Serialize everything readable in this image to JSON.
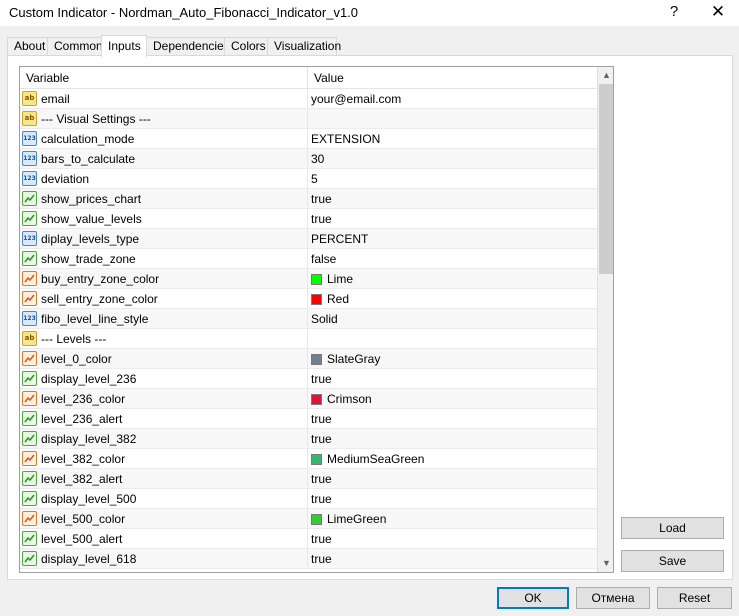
{
  "window": {
    "title": "Custom Indicator - Nordman_Auto_Fibonacci_Indicator_v1.0",
    "help_label": "?",
    "close_label": "✕"
  },
  "tabs": [
    {
      "label": "About"
    },
    {
      "label": "Common"
    },
    {
      "label": "Inputs",
      "active": true
    },
    {
      "label": "Dependencies"
    },
    {
      "label": "Colors"
    },
    {
      "label": "Visualization"
    }
  ],
  "grid": {
    "columns": {
      "variable": "Variable",
      "value": "Value"
    },
    "rows": [
      {
        "icon": "ab-string-icon",
        "type": "ab",
        "variable": "email",
        "value": "your@email.com"
      },
      {
        "icon": "ab-string-icon",
        "type": "ab",
        "variable": "--- Visual Settings ---",
        "value": ""
      },
      {
        "icon": "numeric-icon",
        "type": "num",
        "variable": "calculation_mode",
        "value": "EXTENSION"
      },
      {
        "icon": "numeric-icon",
        "type": "num",
        "variable": "bars_to_calculate",
        "value": "30"
      },
      {
        "icon": "numeric-icon",
        "type": "num",
        "variable": "deviation",
        "value": "5"
      },
      {
        "icon": "boolean-icon",
        "type": "bool",
        "variable": "show_prices_chart",
        "value": "true"
      },
      {
        "icon": "boolean-icon",
        "type": "bool",
        "variable": "show_value_levels",
        "value": "true"
      },
      {
        "icon": "numeric-icon",
        "type": "num",
        "variable": "diplay_levels_type",
        "value": "PERCENT"
      },
      {
        "icon": "boolean-icon",
        "type": "bool",
        "variable": "show_trade_zone",
        "value": "false"
      },
      {
        "icon": "color-icon",
        "type": "color",
        "variable": "buy_entry_zone_color",
        "value": "Lime",
        "swatch": "#00ff00"
      },
      {
        "icon": "color-icon",
        "type": "color",
        "variable": "sell_entry_zone_color",
        "value": "Red",
        "swatch": "#ff0000"
      },
      {
        "icon": "numeric-icon",
        "type": "num",
        "variable": "fibo_level_line_style",
        "value": "Solid"
      },
      {
        "icon": "ab-string-icon",
        "type": "ab",
        "variable": "--- Levels ---",
        "value": ""
      },
      {
        "icon": "color-icon",
        "type": "color",
        "variable": "level_0_color",
        "value": "SlateGray",
        "swatch": "#708090"
      },
      {
        "icon": "boolean-icon",
        "type": "bool",
        "variable": "display_level_236",
        "value": "true"
      },
      {
        "icon": "color-icon",
        "type": "color",
        "variable": "level_236_color",
        "value": "Crimson",
        "swatch": "#dc143c"
      },
      {
        "icon": "boolean-icon",
        "type": "bool",
        "variable": "level_236_alert",
        "value": "true"
      },
      {
        "icon": "boolean-icon",
        "type": "bool",
        "variable": "display_level_382",
        "value": "true"
      },
      {
        "icon": "color-icon",
        "type": "color",
        "variable": "level_382_color",
        "value": "MediumSeaGreen",
        "swatch": "#3cb371"
      },
      {
        "icon": "boolean-icon",
        "type": "bool",
        "variable": "level_382_alert",
        "value": "true"
      },
      {
        "icon": "boolean-icon",
        "type": "bool",
        "variable": "display_level_500",
        "value": "true"
      },
      {
        "icon": "color-icon",
        "type": "color",
        "variable": "level_500_color",
        "value": "LimeGreen",
        "swatch": "#32cd32"
      },
      {
        "icon": "boolean-icon",
        "type": "bool",
        "variable": "level_500_alert",
        "value": "true"
      },
      {
        "icon": "boolean-icon",
        "type": "bool",
        "variable": "display_level_618",
        "value": "true"
      }
    ]
  },
  "side_buttons": {
    "load": "Load",
    "save": "Save"
  },
  "footer_buttons": {
    "ok": "OK",
    "cancel": "Отмена",
    "reset": "Reset"
  },
  "scrollbar": {
    "up_arrow": "▲",
    "down_arrow": "▼"
  }
}
